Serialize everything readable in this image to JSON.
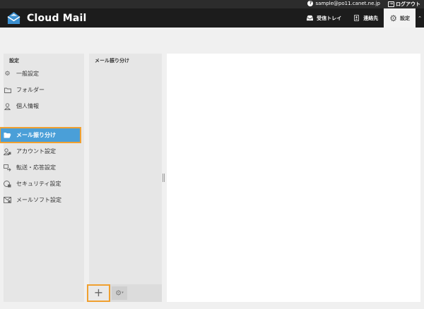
{
  "topbar": {
    "account": "sample@po11.canet.ne.jp",
    "logout": "ログアウト"
  },
  "header": {
    "brand": "Cloud Mail",
    "nav": {
      "inbox": "受信トレイ",
      "contacts": "連絡先",
      "settings": "設定"
    }
  },
  "sidebar": {
    "title": "設定",
    "items": [
      {
        "label": "一般設定",
        "icon": "gear-icon"
      },
      {
        "label": "フォルダー",
        "icon": "folder-icon"
      },
      {
        "label": "個人情報",
        "icon": "person-icon"
      },
      {
        "label": "メール振り分け",
        "icon": "folder-open-icon",
        "active": true
      },
      {
        "label": "アカウント設定",
        "icon": "account-icon"
      },
      {
        "label": "転送・応答設定",
        "icon": "forward-icon"
      },
      {
        "label": "セキュリティ設定",
        "icon": "security-icon"
      },
      {
        "label": "メールソフト設定",
        "icon": "mail-software-icon"
      }
    ]
  },
  "filters": {
    "title": "メール振り分け",
    "add_symbol": "+",
    "settings_symbol": "⚙"
  },
  "colors": {
    "accent": "#4a9fd8",
    "highlight": "#f0a030",
    "header_bg": "#1c1c1c"
  }
}
